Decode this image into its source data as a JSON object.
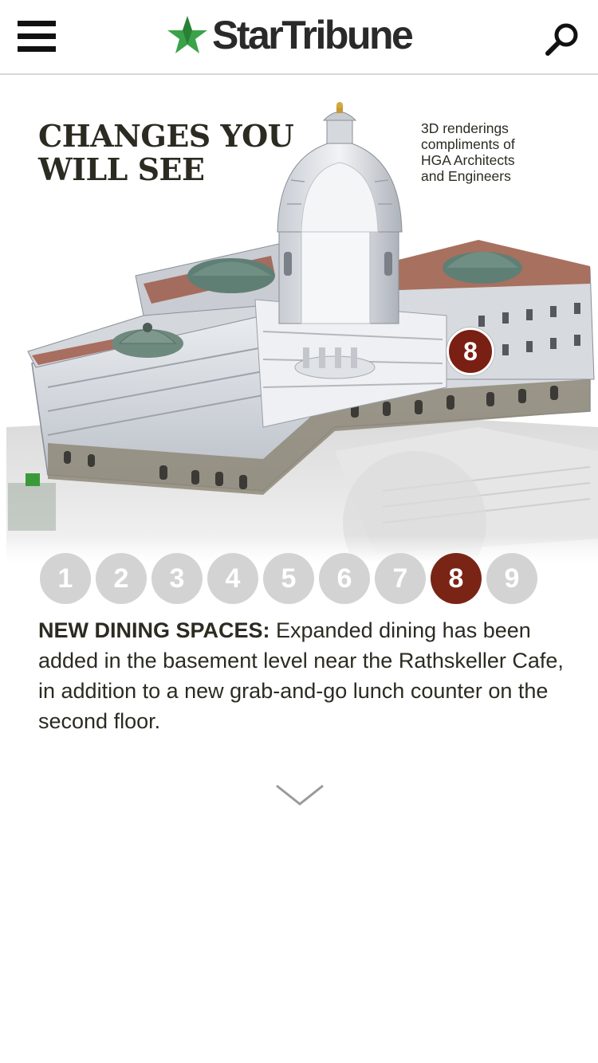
{
  "header": {
    "logo_text": "StarTribune",
    "menu_icon": "hamburger-menu-icon",
    "search_icon": "search-icon",
    "logo_star_color": "#3aa34a"
  },
  "graphic": {
    "title_line1": "CHANGES YOU",
    "title_line2": "WILL SEE",
    "credit_line1": "3D renderings",
    "credit_line2": "compliments of",
    "credit_line3": "HGA Architects",
    "credit_line4": "and Engineers",
    "hotspot_label": "8",
    "image_alt": "3D cutaway rendering of the Minnesota State Capitol"
  },
  "stepper": {
    "steps": [
      "1",
      "2",
      "3",
      "4",
      "5",
      "6",
      "7",
      "8",
      "9"
    ],
    "active_index": 7,
    "active_color": "#7a2416",
    "inactive_color": "#d3d3d3"
  },
  "description": {
    "heading": "NEW DINING SPACES:",
    "body": " Expanded dining has been added in the basement level near the Rathskeller Cafe, in addition to a new grab-and-go lunch counter on the second floor."
  },
  "scroll_icon": "chevron-down-icon"
}
